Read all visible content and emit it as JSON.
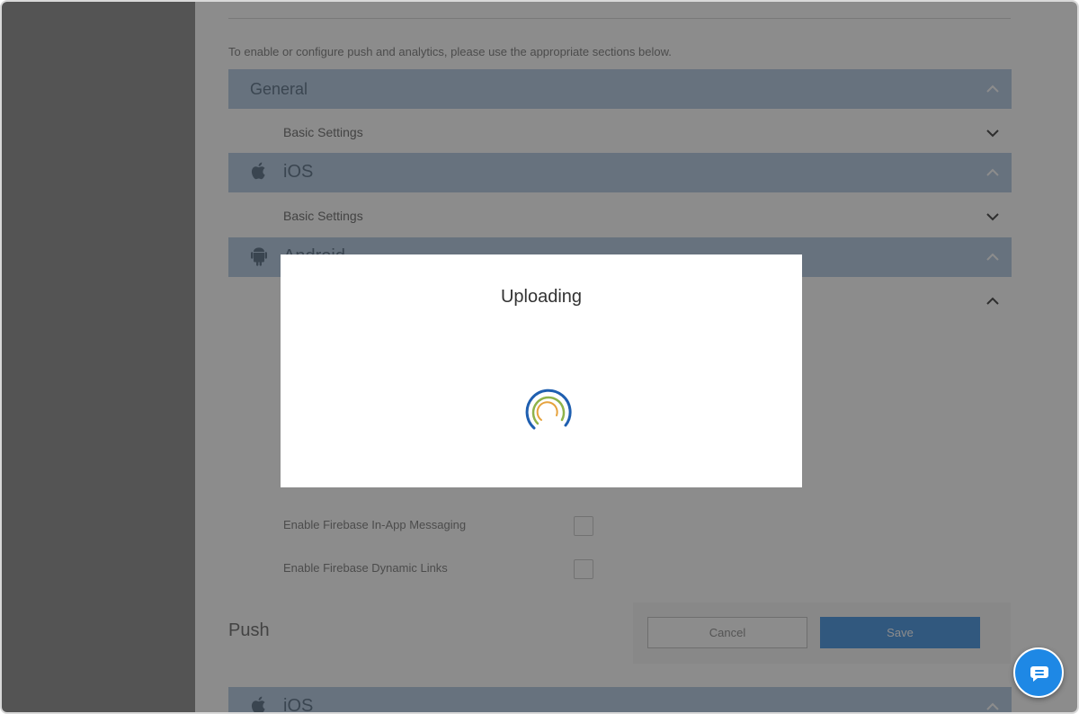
{
  "intro_text": "To enable or configure push and analytics, please use the appropriate sections below.",
  "sections": {
    "general": {
      "title": "General"
    },
    "general_basic": {
      "label": "Basic Settings"
    },
    "ios": {
      "title": "iOS"
    },
    "ios_basic": {
      "label": "Basic Settings"
    },
    "android": {
      "title": "Android"
    }
  },
  "options": {
    "in_app_messaging": "Enable Firebase In-App Messaging",
    "dynamic_links": "Enable Firebase Dynamic Links"
  },
  "push": {
    "title": "Push",
    "ios_title": "iOS"
  },
  "buttons": {
    "cancel": "Cancel",
    "save": "Save"
  },
  "modal": {
    "title": "Uploading"
  },
  "icons": {
    "apple": "apple-icon",
    "android": "android-icon",
    "chevron_up": "chevron-up-icon",
    "chevron_down": "chevron-down-icon",
    "chat": "chat-icon"
  },
  "colors": {
    "accent": "#1e88e5",
    "section_header": "#bcd0e6"
  }
}
